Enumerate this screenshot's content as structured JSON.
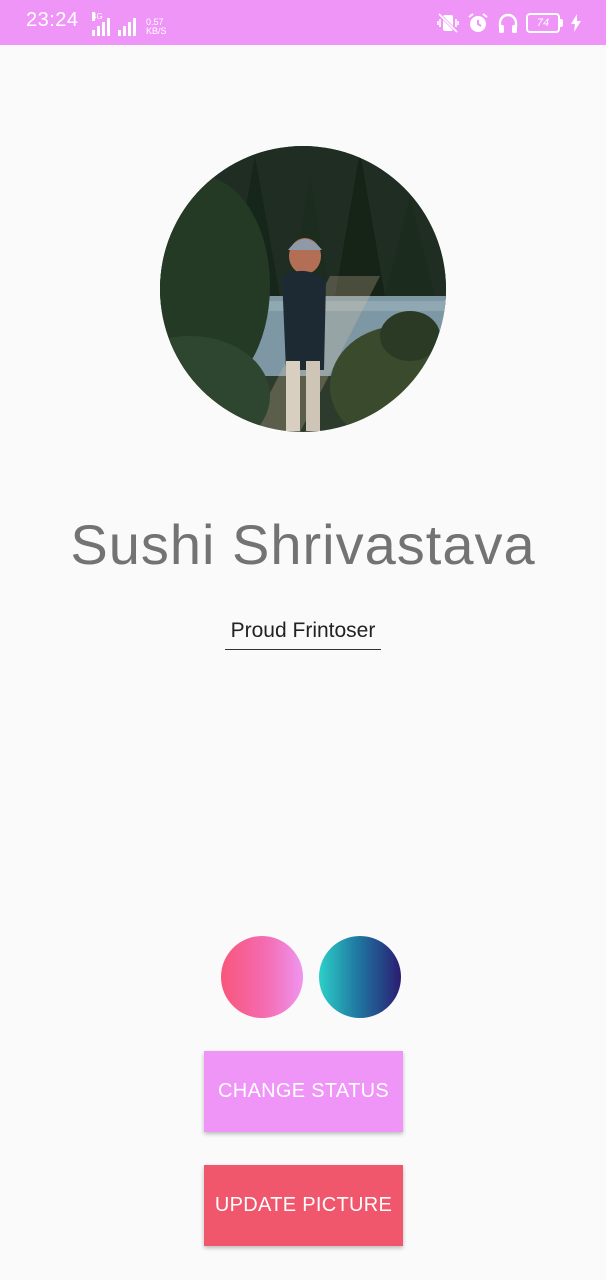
{
  "status_bar": {
    "time": "23:24",
    "network_type": "4G",
    "speed_value": "0.57",
    "speed_unit": "KB/S",
    "battery_level": "74",
    "icons": [
      "signal-icon",
      "signal-icon",
      "vibrate-off-icon",
      "alarm-icon",
      "headphones-icon",
      "battery-icon",
      "charging-icon"
    ]
  },
  "profile": {
    "avatar": "profile-photo",
    "name": "Sushi Shrivastava",
    "status": "Proud Frintoser"
  },
  "theme_swatches": [
    {
      "name": "pink-gradient",
      "colors": [
        "#f8567a",
        "#ef95f0"
      ]
    },
    {
      "name": "teal-navy-gradient",
      "colors": [
        "#2dd0c8",
        "#2a1d72"
      ]
    }
  ],
  "actions": {
    "change_status_label": "CHANGE STATUS",
    "update_picture_label": "UPDATE PICTURE"
  },
  "colors": {
    "status_bar": "#ef95f8",
    "change_status_button": "#ef95f8",
    "update_picture_button": "#f0566c",
    "background": "#fafafa"
  }
}
